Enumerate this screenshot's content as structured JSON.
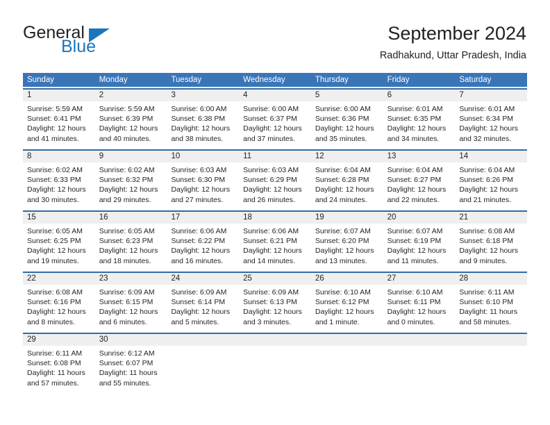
{
  "brand": {
    "name_part1": "General",
    "name_part2": "Blue",
    "accent_color": "#1b75bb"
  },
  "header": {
    "title": "September 2024",
    "location": "Radhakund, Uttar Pradesh, India"
  },
  "theme": {
    "header_bg": "#3a75b8",
    "cell_top_border": "#2e6ca4",
    "day_number_bg": "#efefef"
  },
  "weekdays": [
    "Sunday",
    "Monday",
    "Tuesday",
    "Wednesday",
    "Thursday",
    "Friday",
    "Saturday"
  ],
  "weeks": [
    [
      {
        "day": "1",
        "sunrise": "Sunrise: 5:59 AM",
        "sunset": "Sunset: 6:41 PM",
        "daylight_line1": "Daylight: 12 hours",
        "daylight_line2": "and 41 minutes."
      },
      {
        "day": "2",
        "sunrise": "Sunrise: 5:59 AM",
        "sunset": "Sunset: 6:39 PM",
        "daylight_line1": "Daylight: 12 hours",
        "daylight_line2": "and 40 minutes."
      },
      {
        "day": "3",
        "sunrise": "Sunrise: 6:00 AM",
        "sunset": "Sunset: 6:38 PM",
        "daylight_line1": "Daylight: 12 hours",
        "daylight_line2": "and 38 minutes."
      },
      {
        "day": "4",
        "sunrise": "Sunrise: 6:00 AM",
        "sunset": "Sunset: 6:37 PM",
        "daylight_line1": "Daylight: 12 hours",
        "daylight_line2": "and 37 minutes."
      },
      {
        "day": "5",
        "sunrise": "Sunrise: 6:00 AM",
        "sunset": "Sunset: 6:36 PM",
        "daylight_line1": "Daylight: 12 hours",
        "daylight_line2": "and 35 minutes."
      },
      {
        "day": "6",
        "sunrise": "Sunrise: 6:01 AM",
        "sunset": "Sunset: 6:35 PM",
        "daylight_line1": "Daylight: 12 hours",
        "daylight_line2": "and 34 minutes."
      },
      {
        "day": "7",
        "sunrise": "Sunrise: 6:01 AM",
        "sunset": "Sunset: 6:34 PM",
        "daylight_line1": "Daylight: 12 hours",
        "daylight_line2": "and 32 minutes."
      }
    ],
    [
      {
        "day": "8",
        "sunrise": "Sunrise: 6:02 AM",
        "sunset": "Sunset: 6:33 PM",
        "daylight_line1": "Daylight: 12 hours",
        "daylight_line2": "and 30 minutes."
      },
      {
        "day": "9",
        "sunrise": "Sunrise: 6:02 AM",
        "sunset": "Sunset: 6:32 PM",
        "daylight_line1": "Daylight: 12 hours",
        "daylight_line2": "and 29 minutes."
      },
      {
        "day": "10",
        "sunrise": "Sunrise: 6:03 AM",
        "sunset": "Sunset: 6:30 PM",
        "daylight_line1": "Daylight: 12 hours",
        "daylight_line2": "and 27 minutes."
      },
      {
        "day": "11",
        "sunrise": "Sunrise: 6:03 AM",
        "sunset": "Sunset: 6:29 PM",
        "daylight_line1": "Daylight: 12 hours",
        "daylight_line2": "and 26 minutes."
      },
      {
        "day": "12",
        "sunrise": "Sunrise: 6:04 AM",
        "sunset": "Sunset: 6:28 PM",
        "daylight_line1": "Daylight: 12 hours",
        "daylight_line2": "and 24 minutes."
      },
      {
        "day": "13",
        "sunrise": "Sunrise: 6:04 AM",
        "sunset": "Sunset: 6:27 PM",
        "daylight_line1": "Daylight: 12 hours",
        "daylight_line2": "and 22 minutes."
      },
      {
        "day": "14",
        "sunrise": "Sunrise: 6:04 AM",
        "sunset": "Sunset: 6:26 PM",
        "daylight_line1": "Daylight: 12 hours",
        "daylight_line2": "and 21 minutes."
      }
    ],
    [
      {
        "day": "15",
        "sunrise": "Sunrise: 6:05 AM",
        "sunset": "Sunset: 6:25 PM",
        "daylight_line1": "Daylight: 12 hours",
        "daylight_line2": "and 19 minutes."
      },
      {
        "day": "16",
        "sunrise": "Sunrise: 6:05 AM",
        "sunset": "Sunset: 6:23 PM",
        "daylight_line1": "Daylight: 12 hours",
        "daylight_line2": "and 18 minutes."
      },
      {
        "day": "17",
        "sunrise": "Sunrise: 6:06 AM",
        "sunset": "Sunset: 6:22 PM",
        "daylight_line1": "Daylight: 12 hours",
        "daylight_line2": "and 16 minutes."
      },
      {
        "day": "18",
        "sunrise": "Sunrise: 6:06 AM",
        "sunset": "Sunset: 6:21 PM",
        "daylight_line1": "Daylight: 12 hours",
        "daylight_line2": "and 14 minutes."
      },
      {
        "day": "19",
        "sunrise": "Sunrise: 6:07 AM",
        "sunset": "Sunset: 6:20 PM",
        "daylight_line1": "Daylight: 12 hours",
        "daylight_line2": "and 13 minutes."
      },
      {
        "day": "20",
        "sunrise": "Sunrise: 6:07 AM",
        "sunset": "Sunset: 6:19 PM",
        "daylight_line1": "Daylight: 12 hours",
        "daylight_line2": "and 11 minutes."
      },
      {
        "day": "21",
        "sunrise": "Sunrise: 6:08 AM",
        "sunset": "Sunset: 6:18 PM",
        "daylight_line1": "Daylight: 12 hours",
        "daylight_line2": "and 9 minutes."
      }
    ],
    [
      {
        "day": "22",
        "sunrise": "Sunrise: 6:08 AM",
        "sunset": "Sunset: 6:16 PM",
        "daylight_line1": "Daylight: 12 hours",
        "daylight_line2": "and 8 minutes."
      },
      {
        "day": "23",
        "sunrise": "Sunrise: 6:09 AM",
        "sunset": "Sunset: 6:15 PM",
        "daylight_line1": "Daylight: 12 hours",
        "daylight_line2": "and 6 minutes."
      },
      {
        "day": "24",
        "sunrise": "Sunrise: 6:09 AM",
        "sunset": "Sunset: 6:14 PM",
        "daylight_line1": "Daylight: 12 hours",
        "daylight_line2": "and 5 minutes."
      },
      {
        "day": "25",
        "sunrise": "Sunrise: 6:09 AM",
        "sunset": "Sunset: 6:13 PM",
        "daylight_line1": "Daylight: 12 hours",
        "daylight_line2": "and 3 minutes."
      },
      {
        "day": "26",
        "sunrise": "Sunrise: 6:10 AM",
        "sunset": "Sunset: 6:12 PM",
        "daylight_line1": "Daylight: 12 hours",
        "daylight_line2": "and 1 minute."
      },
      {
        "day": "27",
        "sunrise": "Sunrise: 6:10 AM",
        "sunset": "Sunset: 6:11 PM",
        "daylight_line1": "Daylight: 12 hours",
        "daylight_line2": "and 0 minutes."
      },
      {
        "day": "28",
        "sunrise": "Sunrise: 6:11 AM",
        "sunset": "Sunset: 6:10 PM",
        "daylight_line1": "Daylight: 11 hours",
        "daylight_line2": "and 58 minutes."
      }
    ],
    [
      {
        "day": "29",
        "sunrise": "Sunrise: 6:11 AM",
        "sunset": "Sunset: 6:08 PM",
        "daylight_line1": "Daylight: 11 hours",
        "daylight_line2": "and 57 minutes."
      },
      {
        "day": "30",
        "sunrise": "Sunrise: 6:12 AM",
        "sunset": "Sunset: 6:07 PM",
        "daylight_line1": "Daylight: 11 hours",
        "daylight_line2": "and 55 minutes."
      },
      {
        "day": "",
        "sunrise": "",
        "sunset": "",
        "daylight_line1": "",
        "daylight_line2": ""
      },
      {
        "day": "",
        "sunrise": "",
        "sunset": "",
        "daylight_line1": "",
        "daylight_line2": ""
      },
      {
        "day": "",
        "sunrise": "",
        "sunset": "",
        "daylight_line1": "",
        "daylight_line2": ""
      },
      {
        "day": "",
        "sunrise": "",
        "sunset": "",
        "daylight_line1": "",
        "daylight_line2": ""
      },
      {
        "day": "",
        "sunrise": "",
        "sunset": "",
        "daylight_line1": "",
        "daylight_line2": ""
      }
    ]
  ]
}
